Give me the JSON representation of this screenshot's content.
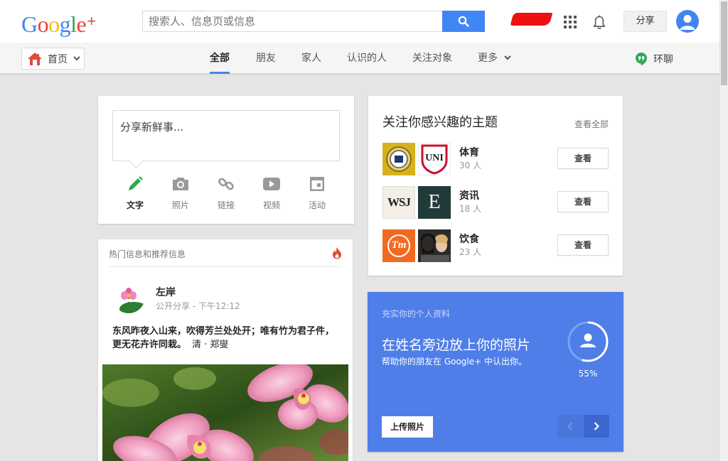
{
  "app": {
    "logo_text": "Google",
    "logo_plus": "+",
    "brand_colors": [
      "#4285f4",
      "#ea4335",
      "#fbbc05",
      "#4285f4",
      "#34a853",
      "#ea4335"
    ]
  },
  "header": {
    "search_placeholder": "搜索人、信息页或信息",
    "share_label": "分享"
  },
  "nav": {
    "home_label": "首页",
    "tabs": [
      {
        "label": "全部",
        "active": true
      },
      {
        "label": "朋友",
        "active": false
      },
      {
        "label": "家人",
        "active": false
      },
      {
        "label": "认识的人",
        "active": false
      },
      {
        "label": "关注对象",
        "active": false
      },
      {
        "label": "更多",
        "active": false
      }
    ],
    "hangouts_label": "环聊"
  },
  "share_card": {
    "prompt": "分享新鲜事...",
    "tools": [
      {
        "label": "文字",
        "icon": "pencil-icon",
        "active": true
      },
      {
        "label": "照片",
        "icon": "camera-icon",
        "active": false
      },
      {
        "label": "链接",
        "icon": "link-icon",
        "active": false
      },
      {
        "label": "视频",
        "icon": "video-icon",
        "active": false
      },
      {
        "label": "活动",
        "icon": "event-icon",
        "active": false
      }
    ]
  },
  "topics_card": {
    "title": "关注你感兴趣的主题",
    "view_all": "查看全部",
    "topics": [
      {
        "name": "体育",
        "count": "30 人",
        "button": "查看"
      },
      {
        "name": "资讯",
        "count": "18 人",
        "button": "查看"
      },
      {
        "name": "饮食",
        "count": "23 人",
        "button": "查看"
      }
    ],
    "thumb_text": {
      "uni": "UNI",
      "wsj": "WSJ",
      "e": "E",
      "tm": "Tm"
    }
  },
  "hot_card": {
    "header": "热门信息和推荐信息",
    "post": {
      "author": "左岸",
      "visibility": "公开分享",
      "time": "下午12:12",
      "text": "东风昨夜入山来，吹得芳兰处处开；唯有竹为君子件，更无花卉许同栽。",
      "attribution": "清 · 郑燮"
    }
  },
  "profile_card": {
    "subtitle": "充实你的个人资料",
    "title": "在姓名旁边放上你的照片",
    "description": "帮助你的朋友在 Google+ 中认出你。",
    "progress_percent": 55,
    "progress_label": "55%",
    "upload_label": "上传照片",
    "background_color": "#4f7ee8"
  }
}
